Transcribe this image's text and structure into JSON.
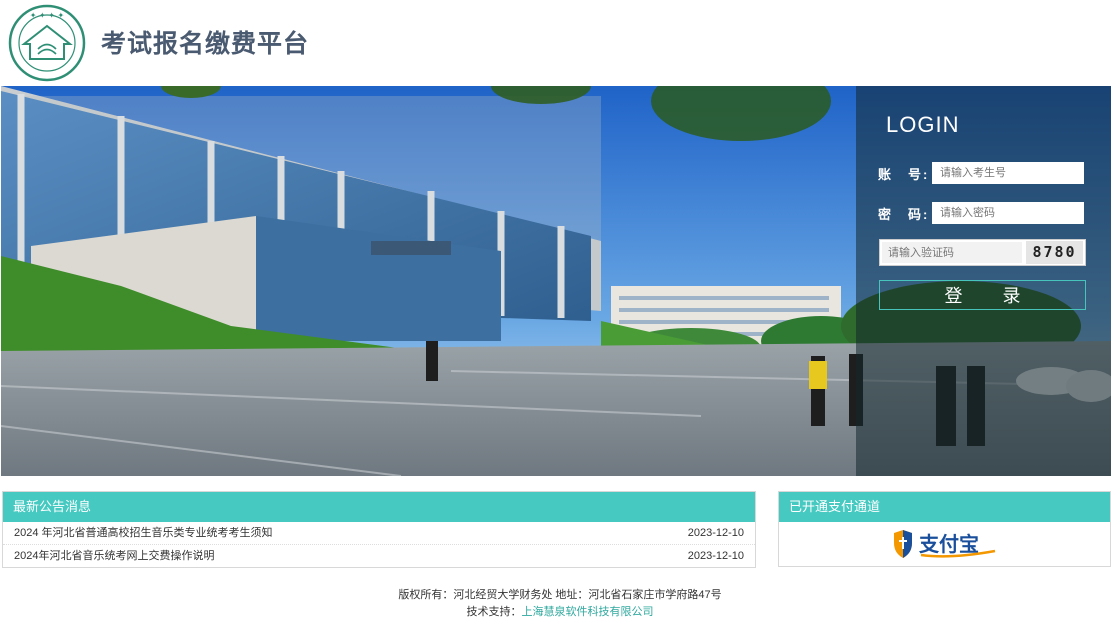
{
  "header": {
    "title": "考试报名缴费平台",
    "logo_icon": "university-seal-icon"
  },
  "login": {
    "title": "LOGIN",
    "account_label": "账　号:",
    "account_placeholder": "请输入考生号",
    "password_label": "密　码:",
    "password_placeholder": "请输入密码",
    "captcha_placeholder": "请输入验证码",
    "captcha_code": "8780",
    "button_label": "登录"
  },
  "notices": {
    "title": "最新公告消息",
    "items": [
      {
        "title": "2024 年河北省普通高校招生音乐类专业统考考生须知",
        "date": "2023-12-10"
      },
      {
        "title": "2024年河北省音乐统考网上交费操作说明",
        "date": "2023-12-10"
      }
    ]
  },
  "payment": {
    "title": "已开通支付通道",
    "channel": "支付宝",
    "icon": "alipay-shield-icon"
  },
  "footer": {
    "copyright": "版权所有：河北经贸大学财务处 地址：河北省石家庄市学府路47号",
    "support_label": "技术支持：",
    "support_link": "上海慧泉软件科技有限公司"
  },
  "colors": {
    "accent": "#45c9c0",
    "title": "#4a5a70",
    "link": "#2ea89e"
  }
}
